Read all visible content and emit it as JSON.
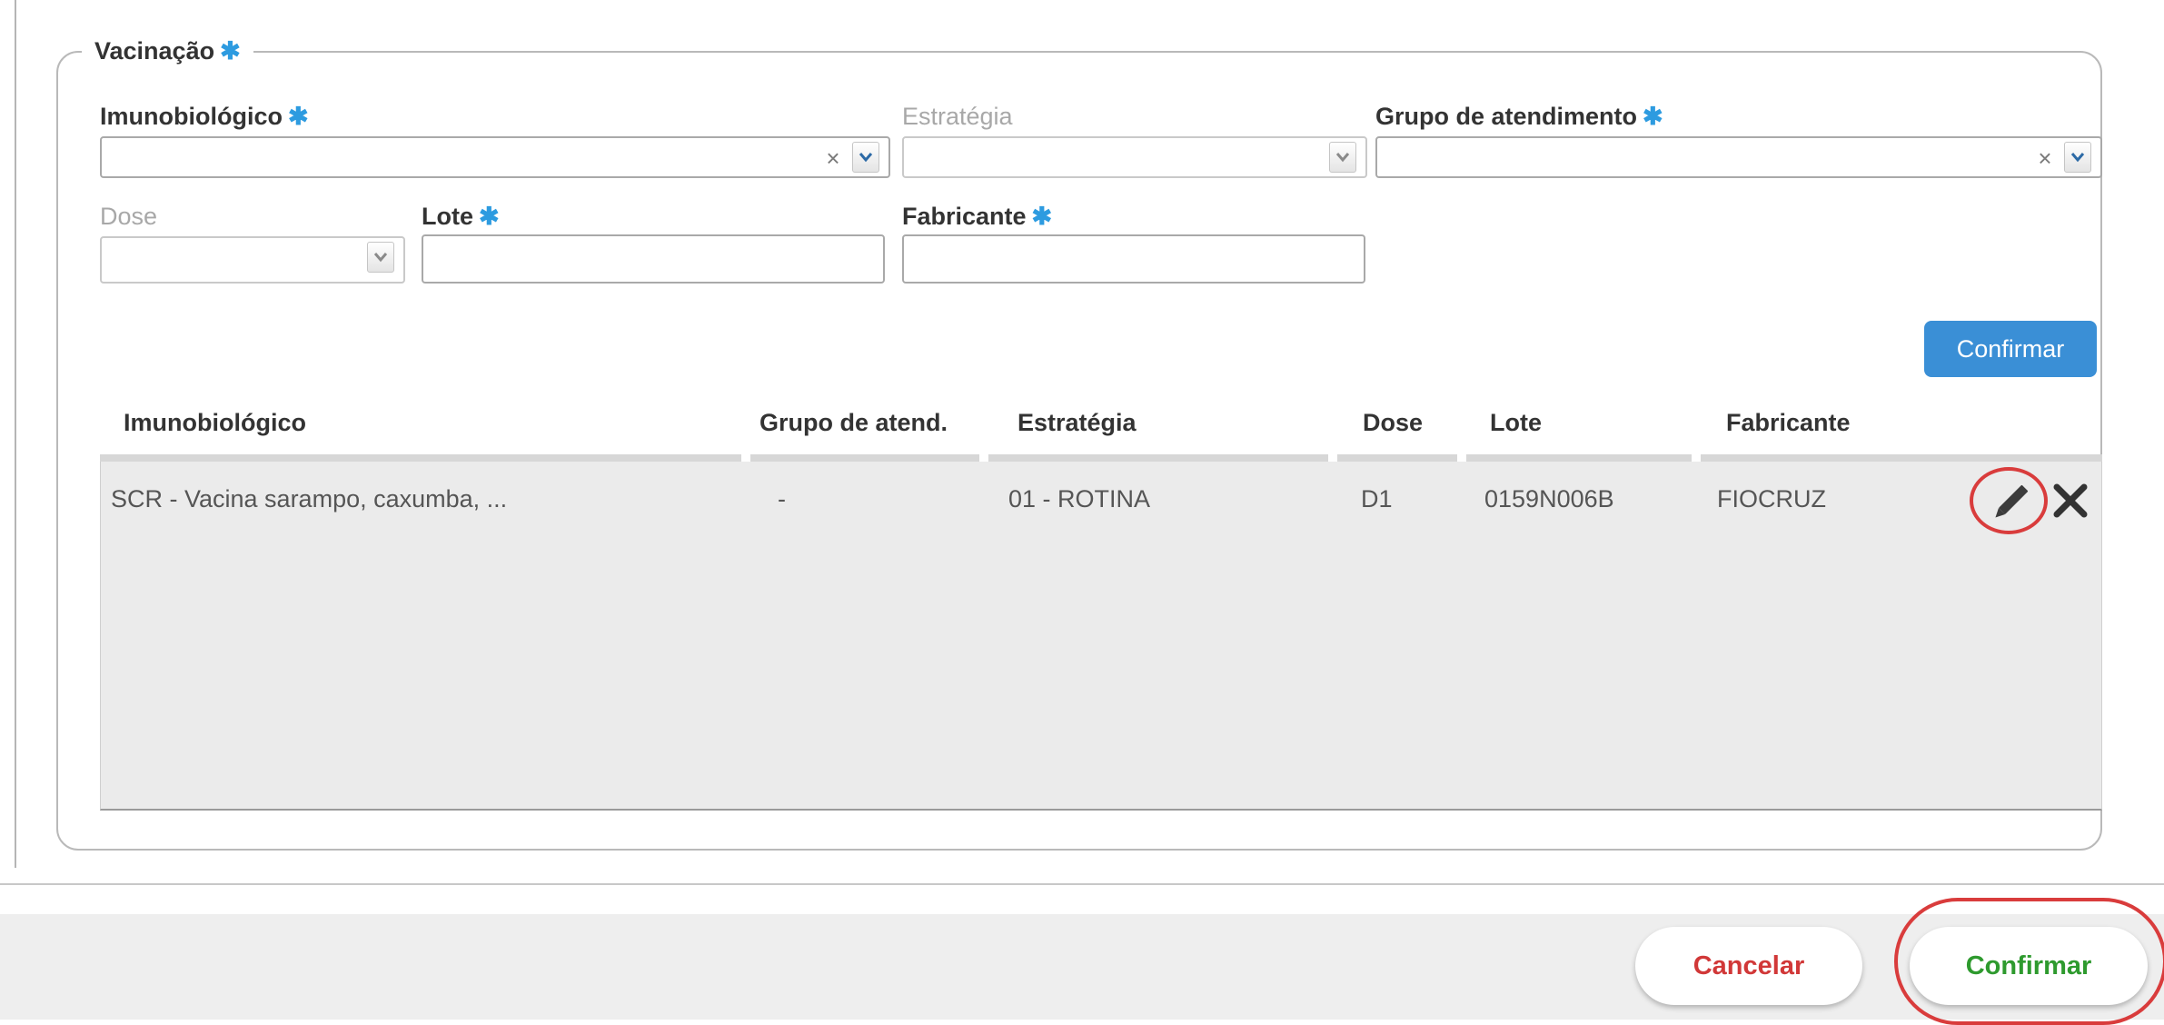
{
  "section": {
    "title": "Vacinação",
    "required_mark": "✱"
  },
  "fields": {
    "imunobiologico": {
      "label": "Imunobiológico",
      "value": ""
    },
    "estrategia": {
      "label": "Estratégia",
      "value": ""
    },
    "grupo_atendimento": {
      "label": "Grupo de atendimento",
      "value": ""
    },
    "dose": {
      "label": "Dose",
      "value": ""
    },
    "lote": {
      "label": "Lote",
      "value": ""
    },
    "fabricante": {
      "label": "Fabricante",
      "value": ""
    },
    "clear_glyph": "×"
  },
  "confirm_small_label": "Confirmar",
  "table": {
    "headers": [
      "Imunobiológico",
      "Grupo de atend.",
      "Estratégia",
      "Dose",
      "Lote",
      "Fabricante"
    ],
    "rows": [
      [
        "SCR - Vacina sarampo, caxumba, ...",
        "-",
        "01 - ROTINA",
        "D1",
        "0159N006B",
        "FIOCRUZ"
      ]
    ]
  },
  "footer": {
    "cancel_label": "Cancelar",
    "confirm_label": "Confirmar"
  },
  "colors": {
    "required": "#2d9be0",
    "primary_button": "#3a8fd6",
    "cancel_text": "#d13838",
    "confirm_text": "#2e9a2e",
    "highlight_ring": "#d93c3c"
  }
}
